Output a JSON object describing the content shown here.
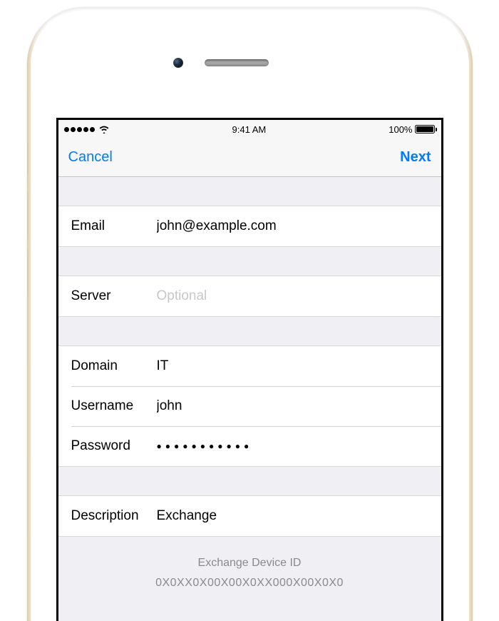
{
  "status_bar": {
    "time": "9:41 AM",
    "battery_percent": "100%"
  },
  "nav": {
    "cancel": "Cancel",
    "next": "Next"
  },
  "fields": {
    "email": {
      "label": "Email",
      "value": "john@example.com"
    },
    "server": {
      "label": "Server",
      "placeholder": "Optional",
      "value": ""
    },
    "domain": {
      "label": "Domain",
      "value": "IT"
    },
    "username": {
      "label": "Username",
      "value": "john"
    },
    "password": {
      "label": "Password",
      "mask": "●●●●●●●●●●●"
    },
    "description": {
      "label": "Description",
      "value": "Exchange"
    }
  },
  "footer": {
    "title": "Exchange Device ID",
    "device_id": "0X0XX0X00X00X0XX000X00X0X0"
  }
}
